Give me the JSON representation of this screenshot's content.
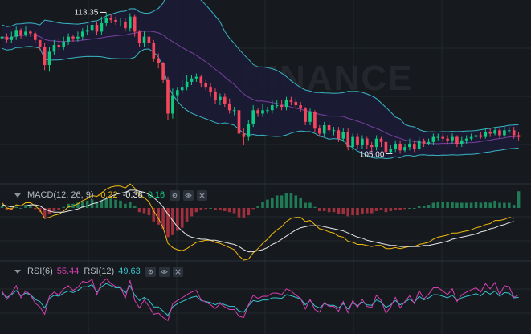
{
  "colors": {
    "background": "#161a1e",
    "grid": "#23282e",
    "up": "#0ecb81",
    "down": "#f6465d",
    "band": "#3ab4c4",
    "band_fill": "#1b1c35",
    "ma": "#7a3fa0",
    "dif": "#f0b90b",
    "dea": "#e6e6e6",
    "rsi6": "#d63fb2",
    "rsi12": "#35c3cf"
  },
  "price_labels": {
    "high": "113.35",
    "low": "105.00"
  },
  "macd": {
    "name": "MACD(12, 26, 9)",
    "dif": "-0.22",
    "dea": "-0.38",
    "hist": "0.16",
    "dif_color": "#f0b90b",
    "dea_color": "#eaecef",
    "hist_color": "#0ecb81"
  },
  "rsi": {
    "name6": "RSI(6)",
    "value6": "55.44",
    "name12": "RSI(12)",
    "value12": "49.63",
    "color6": "#d63fb2",
    "color12": "#35c3cf"
  },
  "icons": [
    "settings-icon",
    "eye-icon",
    "close-icon"
  ],
  "watermark": "BINANCE",
  "chart_data": {
    "type": "candlestick",
    "x": [
      1,
      2,
      3,
      4,
      5,
      6,
      7,
      8,
      9,
      10,
      11,
      12,
      13,
      14,
      15,
      16,
      17,
      18,
      19,
      20,
      21,
      22,
      23,
      24,
      25,
      26,
      27,
      28,
      29,
      30,
      31,
      32,
      33,
      34,
      35,
      36,
      37,
      38,
      39,
      40,
      41,
      42,
      43,
      44,
      45,
      46,
      47,
      48,
      49,
      50,
      51,
      52,
      53,
      54,
      55,
      56,
      57,
      58,
      59,
      60,
      61,
      62,
      63,
      64,
      65,
      66,
      67,
      68,
      69,
      70,
      71,
      72,
      73,
      74,
      75,
      76,
      77,
      78,
      79,
      80,
      81,
      82,
      83,
      84,
      85,
      86,
      87,
      88,
      89,
      90,
      91,
      92,
      93,
      94,
      95,
      96,
      97,
      98,
      99,
      100,
      101,
      102,
      103,
      104,
      105,
      106,
      107,
      108,
      109,
      110
    ],
    "open": [
      111.8,
      111.9,
      111.7,
      111.9,
      112.3,
      112.0,
      112.2,
      112.1,
      111.7,
      111.3,
      110.2,
      111.0,
      111.4,
      111.3,
      111.6,
      111.9,
      111.8,
      111.9,
      112.2,
      112.3,
      112.6,
      112.2,
      112.7,
      113.0,
      112.9,
      112.8,
      112.8,
      112.4,
      113.1,
      112.2,
      111.5,
      111.9,
      111.5,
      110.6,
      110.3,
      109.3,
      107.3,
      108.4,
      108.7,
      108.9,
      109.2,
      109.4,
      109.5,
      109.1,
      108.9,
      108.6,
      108.1,
      108.3,
      107.9,
      107.5,
      107.5,
      106.1,
      105.9,
      106.7,
      107.5,
      107.3,
      107.5,
      107.5,
      107.8,
      107.8,
      107.7,
      108.1,
      108.0,
      107.8,
      107.6,
      106.8,
      107.4,
      106.4,
      106.1,
      106.6,
      106.3,
      106.3,
      105.8,
      106.2,
      105.3,
      105.9,
      105.4,
      105.8,
      105.4,
      105.3,
      105.8,
      105.6,
      105.0,
      105.2,
      105.5,
      105.1,
      105.3,
      105.5,
      105.2,
      105.7,
      105.5,
      105.6,
      105.9,
      105.9,
      105.8,
      105.7,
      105.9,
      105.5,
      105.7,
      105.8,
      105.9,
      106.0,
      105.9,
      106.2,
      106.1,
      106.3,
      106.0,
      106.3,
      106.3,
      106.0
    ],
    "close": [
      111.9,
      111.7,
      111.9,
      112.3,
      112.0,
      112.2,
      112.1,
      111.7,
      111.3,
      110.2,
      111.0,
      111.4,
      111.3,
      111.6,
      111.9,
      111.8,
      111.9,
      112.2,
      112.3,
      112.6,
      112.2,
      112.7,
      113.0,
      112.9,
      112.8,
      112.8,
      112.4,
      113.1,
      112.2,
      111.5,
      111.9,
      111.5,
      110.6,
      110.3,
      109.3,
      107.3,
      108.4,
      108.7,
      108.9,
      109.2,
      109.4,
      109.5,
      109.1,
      108.9,
      108.6,
      108.1,
      108.3,
      107.9,
      107.5,
      107.5,
      106.1,
      105.9,
      106.7,
      107.5,
      107.3,
      107.5,
      107.5,
      107.8,
      107.8,
      107.7,
      108.1,
      108.0,
      107.8,
      107.6,
      106.8,
      107.4,
      106.4,
      106.1,
      106.6,
      106.3,
      106.3,
      105.8,
      106.2,
      105.3,
      105.9,
      105.4,
      105.8,
      105.4,
      105.3,
      105.8,
      105.6,
      105.0,
      105.2,
      105.5,
      105.1,
      105.3,
      105.5,
      105.2,
      105.7,
      105.5,
      105.6,
      105.9,
      105.9,
      105.8,
      105.7,
      105.9,
      105.5,
      105.7,
      105.8,
      105.9,
      106.0,
      105.9,
      106.2,
      106.1,
      106.3,
      106.0,
      106.3,
      106.3,
      106.0,
      105.9
    ],
    "high": [
      112.2,
      112.1,
      112.2,
      112.5,
      112.4,
      112.5,
      112.3,
      112.2,
      111.6,
      111.5,
      111.3,
      111.7,
      111.8,
      111.9,
      112.1,
      112.0,
      112.2,
      112.4,
      112.6,
      112.9,
      112.8,
      113.1,
      113.35,
      113.2,
      113.1,
      113.0,
      113.0,
      113.3,
      113.2,
      112.3,
      112.2,
      111.9,
      111.7,
      110.9,
      110.4,
      109.5,
      108.8,
      108.9,
      109.3,
      109.6,
      109.6,
      109.7,
      109.6,
      109.3,
      109.1,
      108.8,
      108.5,
      108.5,
      108.2,
      107.7,
      107.6,
      106.4,
      106.9,
      107.8,
      107.6,
      107.9,
      107.7,
      108.1,
      108.1,
      108.1,
      108.3,
      108.3,
      108.2,
      108.0,
      107.7,
      107.6,
      107.5,
      106.6,
      106.8,
      106.8,
      106.5,
      106.5,
      106.4,
      106.4,
      106.1,
      106.1,
      106.0,
      105.9,
      105.6,
      106.0,
      105.9,
      105.7,
      105.4,
      105.7,
      105.7,
      105.5,
      105.8,
      105.7,
      105.9,
      105.8,
      105.8,
      106.1,
      106.1,
      106.1,
      106.0,
      106.1,
      106.0,
      105.9,
      106.0,
      106.1,
      106.2,
      106.2,
      106.4,
      106.4,
      106.5,
      106.4,
      106.5,
      106.5,
      106.5,
      106.2
    ],
    "low": [
      111.5,
      111.5,
      111.5,
      111.7,
      111.8,
      111.9,
      111.9,
      111.5,
      111.1,
      109.9,
      109.8,
      110.8,
      111.1,
      111.1,
      111.4,
      111.6,
      111.6,
      111.7,
      112.0,
      112.1,
      112.0,
      112.0,
      112.5,
      112.7,
      112.6,
      112.5,
      112.2,
      112.2,
      111.9,
      111.3,
      111.3,
      111.3,
      110.4,
      110.0,
      109.1,
      106.9,
      107.0,
      108.1,
      108.5,
      108.7,
      109.0,
      109.2,
      108.9,
      108.7,
      108.3,
      107.9,
      107.8,
      107.7,
      107.3,
      107.2,
      105.9,
      105.4,
      105.7,
      106.5,
      107.1,
      107.1,
      107.3,
      107.3,
      107.6,
      107.5,
      107.5,
      107.8,
      107.6,
      107.4,
      106.6,
      106.6,
      106.2,
      105.9,
      105.9,
      106.1,
      106.0,
      105.6,
      105.6,
      105.1,
      105.1,
      105.2,
      105.2,
      105.2,
      105.0,
      105.1,
      105.3,
      104.9,
      104.9,
      105.0,
      104.9,
      105.0,
      105.1,
      105.0,
      105.1,
      105.3,
      105.4,
      105.4,
      105.7,
      105.6,
      105.5,
      105.5,
      105.3,
      105.3,
      105.5,
      105.7,
      105.7,
      105.8,
      105.8,
      105.9,
      106.0,
      105.8,
      105.9,
      106.1,
      105.8,
      105.7
    ],
    "ylim": [
      104.2,
      113.9
    ],
    "indicators": {
      "macd_dif": [
        0.05,
        0.0,
        -0.01,
        0.03,
        0.02,
        0.05,
        0.05,
        0.02,
        -0.02,
        -0.1,
        -0.09,
        -0.07,
        -0.06,
        -0.03,
        0.01,
        0.02,
        0.04,
        0.07,
        0.09,
        0.12,
        0.11,
        0.14,
        0.18,
        0.2,
        0.21,
        0.21,
        0.19,
        0.23,
        0.19,
        0.12,
        0.1,
        0.06,
        -0.03,
        -0.1,
        -0.19,
        -0.34,
        -0.38,
        -0.4,
        -0.41,
        -0.39,
        -0.36,
        -0.33,
        -0.32,
        -0.31,
        -0.31,
        -0.33,
        -0.34,
        -0.36,
        -0.38,
        -0.4,
        -0.46,
        -0.5,
        -0.49,
        -0.43,
        -0.39,
        -0.34,
        -0.3,
        -0.25,
        -0.21,
        -0.18,
        -0.13,
        -0.1,
        -0.09,
        -0.09,
        -0.13,
        -0.12,
        -0.16,
        -0.2,
        -0.21,
        -0.23,
        -0.24,
        -0.27,
        -0.28,
        -0.32,
        -0.33,
        -0.35,
        -0.35,
        -0.36,
        -0.37,
        -0.36,
        -0.36,
        -0.39,
        -0.39,
        -0.38,
        -0.39,
        -0.38,
        -0.37,
        -0.37,
        -0.35,
        -0.34,
        -0.33,
        -0.3,
        -0.28,
        -0.27,
        -0.26,
        -0.24,
        -0.24,
        -0.23,
        -0.22,
        -0.21,
        -0.19,
        -0.18,
        -0.16,
        -0.15,
        -0.12,
        -0.12,
        -0.11,
        -0.09,
        -0.1,
        -0.22
      ],
      "macd_dea": [
        0.03,
        0.02,
        0.01,
        0.02,
        0.02,
        0.02,
        0.03,
        0.03,
        0.02,
        -0.01,
        -0.03,
        -0.04,
        -0.04,
        -0.04,
        -0.03,
        -0.02,
        -0.01,
        0.01,
        0.02,
        0.04,
        0.05,
        0.07,
        0.09,
        0.11,
        0.13,
        0.14,
        0.15,
        0.17,
        0.17,
        0.16,
        0.15,
        0.13,
        0.1,
        0.06,
        0.01,
        -0.06,
        -0.12,
        -0.18,
        -0.22,
        -0.26,
        -0.28,
        -0.29,
        -0.3,
        -0.3,
        -0.31,
        -0.31,
        -0.32,
        -0.33,
        -0.34,
        -0.35,
        -0.37,
        -0.4,
        -0.42,
        -0.42,
        -0.41,
        -0.4,
        -0.38,
        -0.35,
        -0.33,
        -0.3,
        -0.27,
        -0.24,
        -0.21,
        -0.19,
        -0.18,
        -0.17,
        -0.17,
        -0.17,
        -0.18,
        -0.19,
        -0.2,
        -0.21,
        -0.22,
        -0.24,
        -0.26,
        -0.28,
        -0.29,
        -0.31,
        -0.32,
        -0.33,
        -0.34,
        -0.35,
        -0.36,
        -0.36,
        -0.37,
        -0.37,
        -0.37,
        -0.37,
        -0.37,
        -0.36,
        -0.36,
        -0.35,
        -0.34,
        -0.33,
        -0.32,
        -0.3,
        -0.29,
        -0.28,
        -0.27,
        -0.26,
        -0.25,
        -0.23,
        -0.22,
        -0.2,
        -0.19,
        -0.17,
        -0.16,
        -0.14,
        -0.13,
        -0.38
      ],
      "macd_hist": [
        0.02,
        -0.02,
        -0.02,
        0.01,
        0.0,
        0.03,
        0.02,
        -0.01,
        -0.04,
        -0.09,
        -0.06,
        -0.03,
        -0.02,
        0.01,
        0.04,
        0.04,
        0.05,
        0.06,
        0.07,
        0.08,
        0.06,
        0.07,
        0.09,
        0.09,
        0.08,
        0.07,
        0.04,
        0.06,
        0.02,
        -0.04,
        -0.05,
        -0.07,
        -0.13,
        -0.16,
        -0.2,
        -0.28,
        -0.26,
        -0.22,
        -0.19,
        -0.13,
        -0.08,
        -0.04,
        -0.02,
        -0.01,
        0.0,
        -0.02,
        -0.02,
        -0.03,
        -0.04,
        -0.05,
        -0.09,
        -0.1,
        -0.07,
        -0.01,
        0.02,
        0.06,
        0.08,
        0.1,
        0.12,
        0.12,
        0.14,
        0.14,
        0.12,
        0.1,
        0.05,
        0.05,
        0.01,
        -0.03,
        -0.03,
        -0.04,
        -0.04,
        -0.06,
        -0.06,
        -0.08,
        -0.07,
        -0.07,
        -0.06,
        -0.05,
        -0.05,
        -0.03,
        -0.02,
        -0.04,
        -0.03,
        -0.02,
        -0.02,
        -0.01,
        0.0,
        0.0,
        0.02,
        0.02,
        0.03,
        0.05,
        0.06,
        0.06,
        0.06,
        0.06,
        0.05,
        0.05,
        0.05,
        0.05,
        0.06,
        0.05,
        0.06,
        0.05,
        0.07,
        0.05,
        0.05,
        0.05,
        0.03,
        0.16
      ],
      "rsi6": [
        62,
        46,
        57,
        72,
        49,
        62,
        55,
        39,
        32,
        18,
        52,
        60,
        54,
        66,
        72,
        63,
        69,
        80,
        78,
        84,
        55,
        77,
        85,
        76,
        70,
        70,
        48,
        82,
        44,
        30,
        45,
        33,
        18,
        20,
        12,
        6,
        38,
        44,
        49,
        55,
        60,
        63,
        45,
        41,
        36,
        29,
        38,
        32,
        27,
        27,
        14,
        12,
        36,
        54,
        48,
        52,
        52,
        58,
        58,
        55,
        66,
        62,
        54,
        48,
        28,
        46,
        27,
        22,
        40,
        33,
        33,
        24,
        42,
        21,
        44,
        31,
        46,
        33,
        31,
        54,
        44,
        20,
        32,
        50,
        30,
        42,
        53,
        38,
        63,
        47,
        56,
        68,
        68,
        62,
        55,
        66,
        42,
        55,
        60,
        64,
        68,
        60,
        76,
        66,
        78,
        55,
        72,
        70,
        50,
        55
      ],
      "rsi12": [
        58,
        50,
        55,
        63,
        53,
        58,
        55,
        46,
        42,
        30,
        48,
        54,
        52,
        58,
        62,
        59,
        63,
        70,
        70,
        74,
        60,
        70,
        76,
        72,
        68,
        68,
        58,
        72,
        54,
        44,
        50,
        44,
        32,
        32,
        24,
        16,
        32,
        38,
        42,
        46,
        50,
        52,
        44,
        42,
        40,
        36,
        40,
        36,
        33,
        33,
        24,
        22,
        34,
        44,
        42,
        45,
        45,
        49,
        49,
        48,
        55,
        53,
        50,
        47,
        36,
        44,
        34,
        30,
        38,
        35,
        35,
        30,
        38,
        28,
        40,
        34,
        41,
        36,
        35,
        45,
        41,
        31,
        36,
        44,
        36,
        41,
        47,
        40,
        52,
        45,
        49,
        55,
        55,
        52,
        49,
        54,
        44,
        49,
        52,
        54,
        57,
        53,
        61,
        56,
        62,
        52,
        59,
        58,
        49,
        50
      ]
    }
  }
}
